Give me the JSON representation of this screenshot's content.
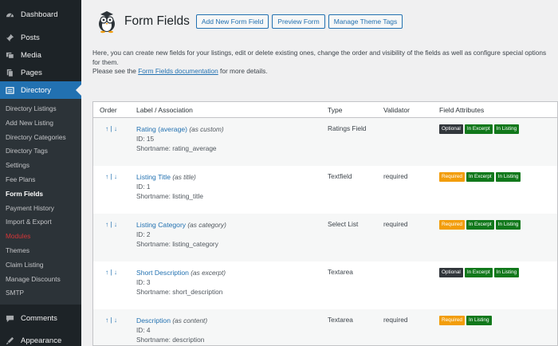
{
  "sidebar": {
    "top_items": [
      {
        "label": "Dashboard",
        "icon": "dashboard-icon"
      },
      {
        "label": "Posts",
        "icon": "pin-icon"
      },
      {
        "label": "Media",
        "icon": "media-icon"
      },
      {
        "label": "Pages",
        "icon": "pages-icon"
      },
      {
        "label": "Directory",
        "icon": "directory-icon"
      }
    ],
    "sub_items": [
      "Directory Listings",
      "Add New Listing",
      "Directory Categories",
      "Directory Tags",
      "Settings",
      "Fee Plans",
      "Form Fields",
      "Payment History",
      "Import & Export",
      "Modules",
      "Themes",
      "Claim Listing",
      "Manage Discounts",
      "SMTP"
    ],
    "bottom_items": [
      {
        "label": "Comments",
        "icon": "comments-icon"
      },
      {
        "label": "Appearance",
        "icon": "appearance-icon"
      }
    ]
  },
  "header": {
    "title": "Form Fields",
    "buttons": [
      "Add New Form Field",
      "Preview Form",
      "Manage Theme Tags"
    ]
  },
  "intro": {
    "line1": "Here, you can create new fields for your listings, edit or delete existing ones, change the order and visibility of the fields as well as configure special options for them.",
    "line2_before": "Please see the ",
    "line2_link": "Form Fields documentation",
    "line2_after": " for more details."
  },
  "table": {
    "headers": [
      "Order",
      "Label / Association",
      "Type",
      "Validator",
      "Field Attributes"
    ],
    "order_glyph": "↑ | ↓",
    "rows": [
      {
        "label": "Rating (average)",
        "assoc": "(as custom)",
        "id": "ID: 15",
        "shortname": "Shortname: rating_average",
        "type": "Ratings Field",
        "validator": "",
        "attrs": [
          "Optional",
          "In Excerpt",
          "In Listing"
        ]
      },
      {
        "label": "Listing Title",
        "assoc": "(as title)",
        "id": "ID: 1",
        "shortname": "Shortname: listing_title",
        "type": "Textfield",
        "validator": "required",
        "attrs": [
          "Required",
          "In Excerpt",
          "In Listing"
        ]
      },
      {
        "label": "Listing Category",
        "assoc": "(as category)",
        "id": "ID: 2",
        "shortname": "Shortname: listing_category",
        "type": "Select List",
        "validator": "required",
        "attrs": [
          "Required",
          "In Excerpt",
          "In Listing"
        ]
      },
      {
        "label": "Short Description",
        "assoc": "(as excerpt)",
        "id": "ID: 3",
        "shortname": "Shortname: short_description",
        "type": "Textarea",
        "validator": "",
        "attrs": [
          "Optional",
          "In Excerpt",
          "In Listing"
        ]
      },
      {
        "label": "Description",
        "assoc": "(as content)",
        "id": "ID: 4",
        "shortname": "Shortname: description",
        "type": "Textarea",
        "validator": "required",
        "attrs": [
          "Required",
          "In Listing"
        ]
      }
    ]
  },
  "colors": {
    "sidebar_bg": "#1d2327",
    "accent": "#2271b1",
    "badge_optional": "#32373c",
    "badge_required": "#f29d0b",
    "badge_green": "#11781b"
  }
}
